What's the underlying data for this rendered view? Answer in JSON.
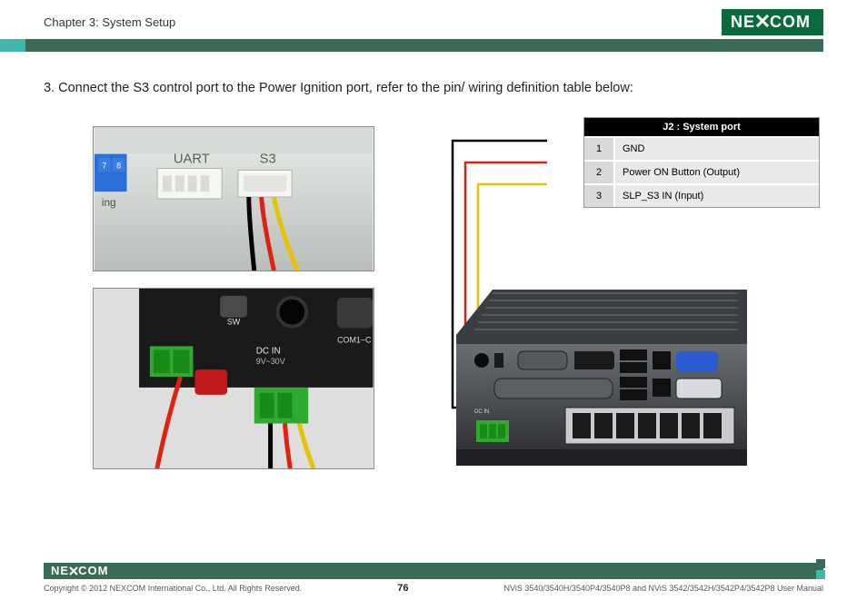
{
  "header": {
    "chapter": "Chapter 3: System Setup",
    "logo_text": "NE COM"
  },
  "instruction": {
    "number": "3.",
    "text": "Connect the S3 control port to the Power Ignition port, refer to the pin/ wiring definition table below:"
  },
  "pin_table": {
    "title": "J2 : System port",
    "rows": [
      {
        "pin": "1",
        "label": "GND"
      },
      {
        "pin": "2",
        "label": "Power ON Button (Output)"
      },
      {
        "pin": "3",
        "label": "SLP_S3 IN (Input)"
      }
    ]
  },
  "photo1": {
    "labels": {
      "uart": "UART",
      "s3": "S3",
      "p7": "7",
      "p8": "8",
      "ing": "ing"
    }
  },
  "photo2": {
    "labels": {
      "sw": "SW",
      "dcin": "DC IN",
      "volt": "9V~30V",
      "com": "COM1~C"
    }
  },
  "footer": {
    "logo_text": "NE COM",
    "copyright": "Copyright © 2012 NEXCOM International Co., Ltd. All Rights Reserved.",
    "page": "76",
    "manual": "NViS 3540/3540H/3540P4/3540P8 and NViS 3542/3542H/3542P4/3542P8 User Manual"
  }
}
